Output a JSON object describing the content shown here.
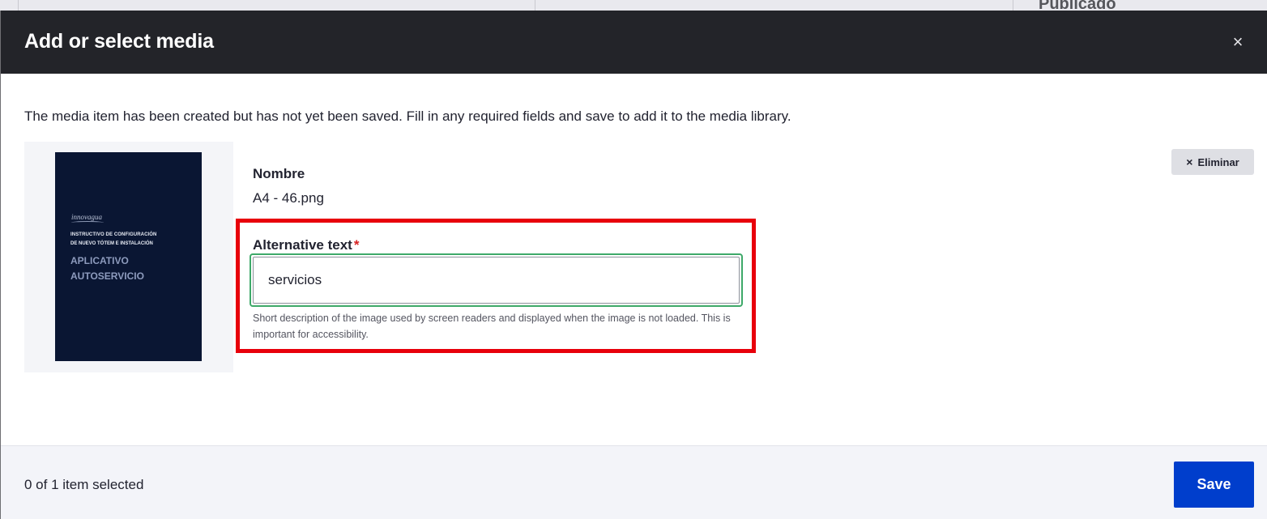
{
  "background": {
    "heading_text": "Publicado"
  },
  "modal": {
    "title": "Add or select media",
    "close_glyph": "×",
    "message": "The media item has been created but has not yet been saved. Fill in any required fields and save to add it to the media library."
  },
  "thumbnail": {
    "logo": "innovagua",
    "line1": "INSTRUCTIVO DE CONFIGURACIÓN",
    "line2": "DE NUEVO TÓTEM E INSTALACIÓN",
    "line3": "APLICATIVO",
    "line4": "AUTOSERVICIO"
  },
  "media_item": {
    "name_label": "Nombre",
    "name_value": "A4 - 46.png",
    "remove_icon": "×",
    "remove_label": "Eliminar"
  },
  "alt_text_field": {
    "label": "Alternative text",
    "required_marker": "*",
    "value": "servicios",
    "help": "Short description of the image used by screen readers and displayed when the image is not loaded. This is important for accessibility."
  },
  "footer": {
    "status": "0 of 1 item selected",
    "save_label": "Save"
  },
  "colors": {
    "header_bg": "#232429",
    "save_button": "#003ecc",
    "highlight": "#e8000b",
    "input_focus": "#3ea969",
    "required": "#d72222"
  }
}
